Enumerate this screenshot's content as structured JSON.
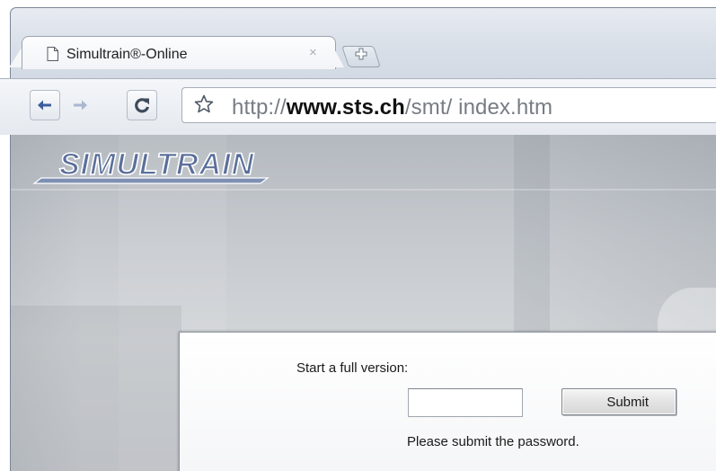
{
  "browser": {
    "tab": {
      "title": "Simultrain®-Online",
      "close_glyph": "×",
      "icon": "page-icon"
    },
    "new_tab_icon": "new-tab-icon",
    "toolbar": {
      "back_icon": "back-arrow-icon",
      "forward_icon": "forward-arrow-icon",
      "reload_icon": "reload-icon",
      "bookmark_icon": "star-icon"
    },
    "address_bar": {
      "scheme": "http://",
      "host": "www.sts.ch",
      "path": "/smt/",
      "file": " index.htm"
    }
  },
  "page": {
    "logo_text": "SIMULTRAIN",
    "login": {
      "prompt": "Start a full version:",
      "password_value": "",
      "submit_label": "Submit",
      "hint": "Please submit the password."
    }
  },
  "colors": {
    "logo_fill": "#5a6f9a",
    "logo_outline": "#ffffff",
    "tab_border": "#9aa3b0",
    "accent_arrow": "#3b5e9c"
  }
}
